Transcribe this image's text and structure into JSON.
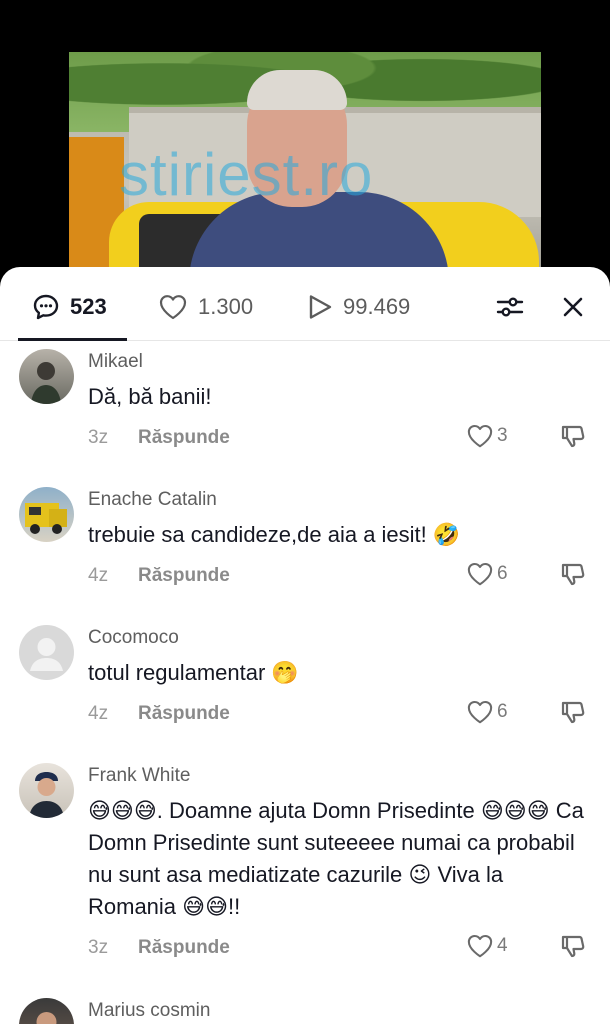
{
  "video": {
    "watermark": "stiriest.ro"
  },
  "tabs": {
    "comments_count": "523",
    "likes_count": "1.300",
    "views_count": "99.469"
  },
  "comments": [
    {
      "author": "Mikael",
      "text": "Dă, bă banii!",
      "time": "3z",
      "reply": "Răspunde",
      "likes": "3"
    },
    {
      "author": "Enache Catalin",
      "text": "trebuie sa candideze,de aia a iesit! 🤣",
      "time": "4z",
      "reply": "Răspunde",
      "likes": "6"
    },
    {
      "author": "Cocomoco",
      "text": "totul regulamentar 🤭",
      "time": "4z",
      "reply": "Răspunde",
      "likes": "6"
    },
    {
      "author": "Frank White",
      "text": "😅😅😅. Doamne ajuta Domn Prisedinte 😅😅😅 Ca Domn Prisedinte sunt suteeeee numai ca probabil nu sunt asa mediatizate cazurile 😉 Viva la Romania 😅😅!!",
      "time": "3z",
      "reply": "Răspunde",
      "likes": "4"
    },
    {
      "author": "Marius cosmin"
    }
  ],
  "colors": {
    "text": "#161823",
    "muted": "#9a9a9a",
    "sheet": "#ffffff"
  }
}
